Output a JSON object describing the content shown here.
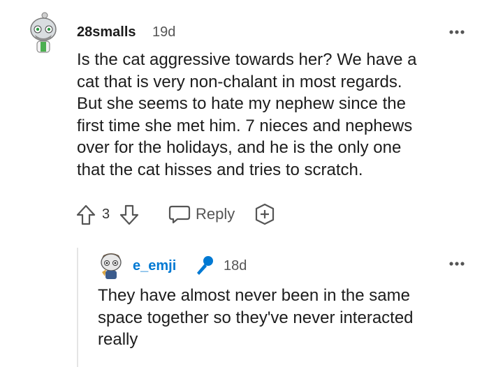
{
  "comment": {
    "username": "28smalls",
    "age": "19d",
    "body_lines": [
      "Is the cat aggressive towards her? We have a",
      "cat that is very non-chalant in most regards.",
      "But she seems to hate my nephew since the",
      "first time she met him. 7 nieces and nephews",
      "over for the holidays, and he is the only one",
      "that the cat hisses and tries to scratch."
    ],
    "vote_count": "3",
    "reply_label": "Reply"
  },
  "reply": {
    "username": "e_emji",
    "age": "18d",
    "body_lines": [
      "They have almost never been in the same",
      "space together so they've never interacted",
      "really"
    ],
    "username_color": "#0079d3",
    "mic_color": "#0079d3"
  }
}
